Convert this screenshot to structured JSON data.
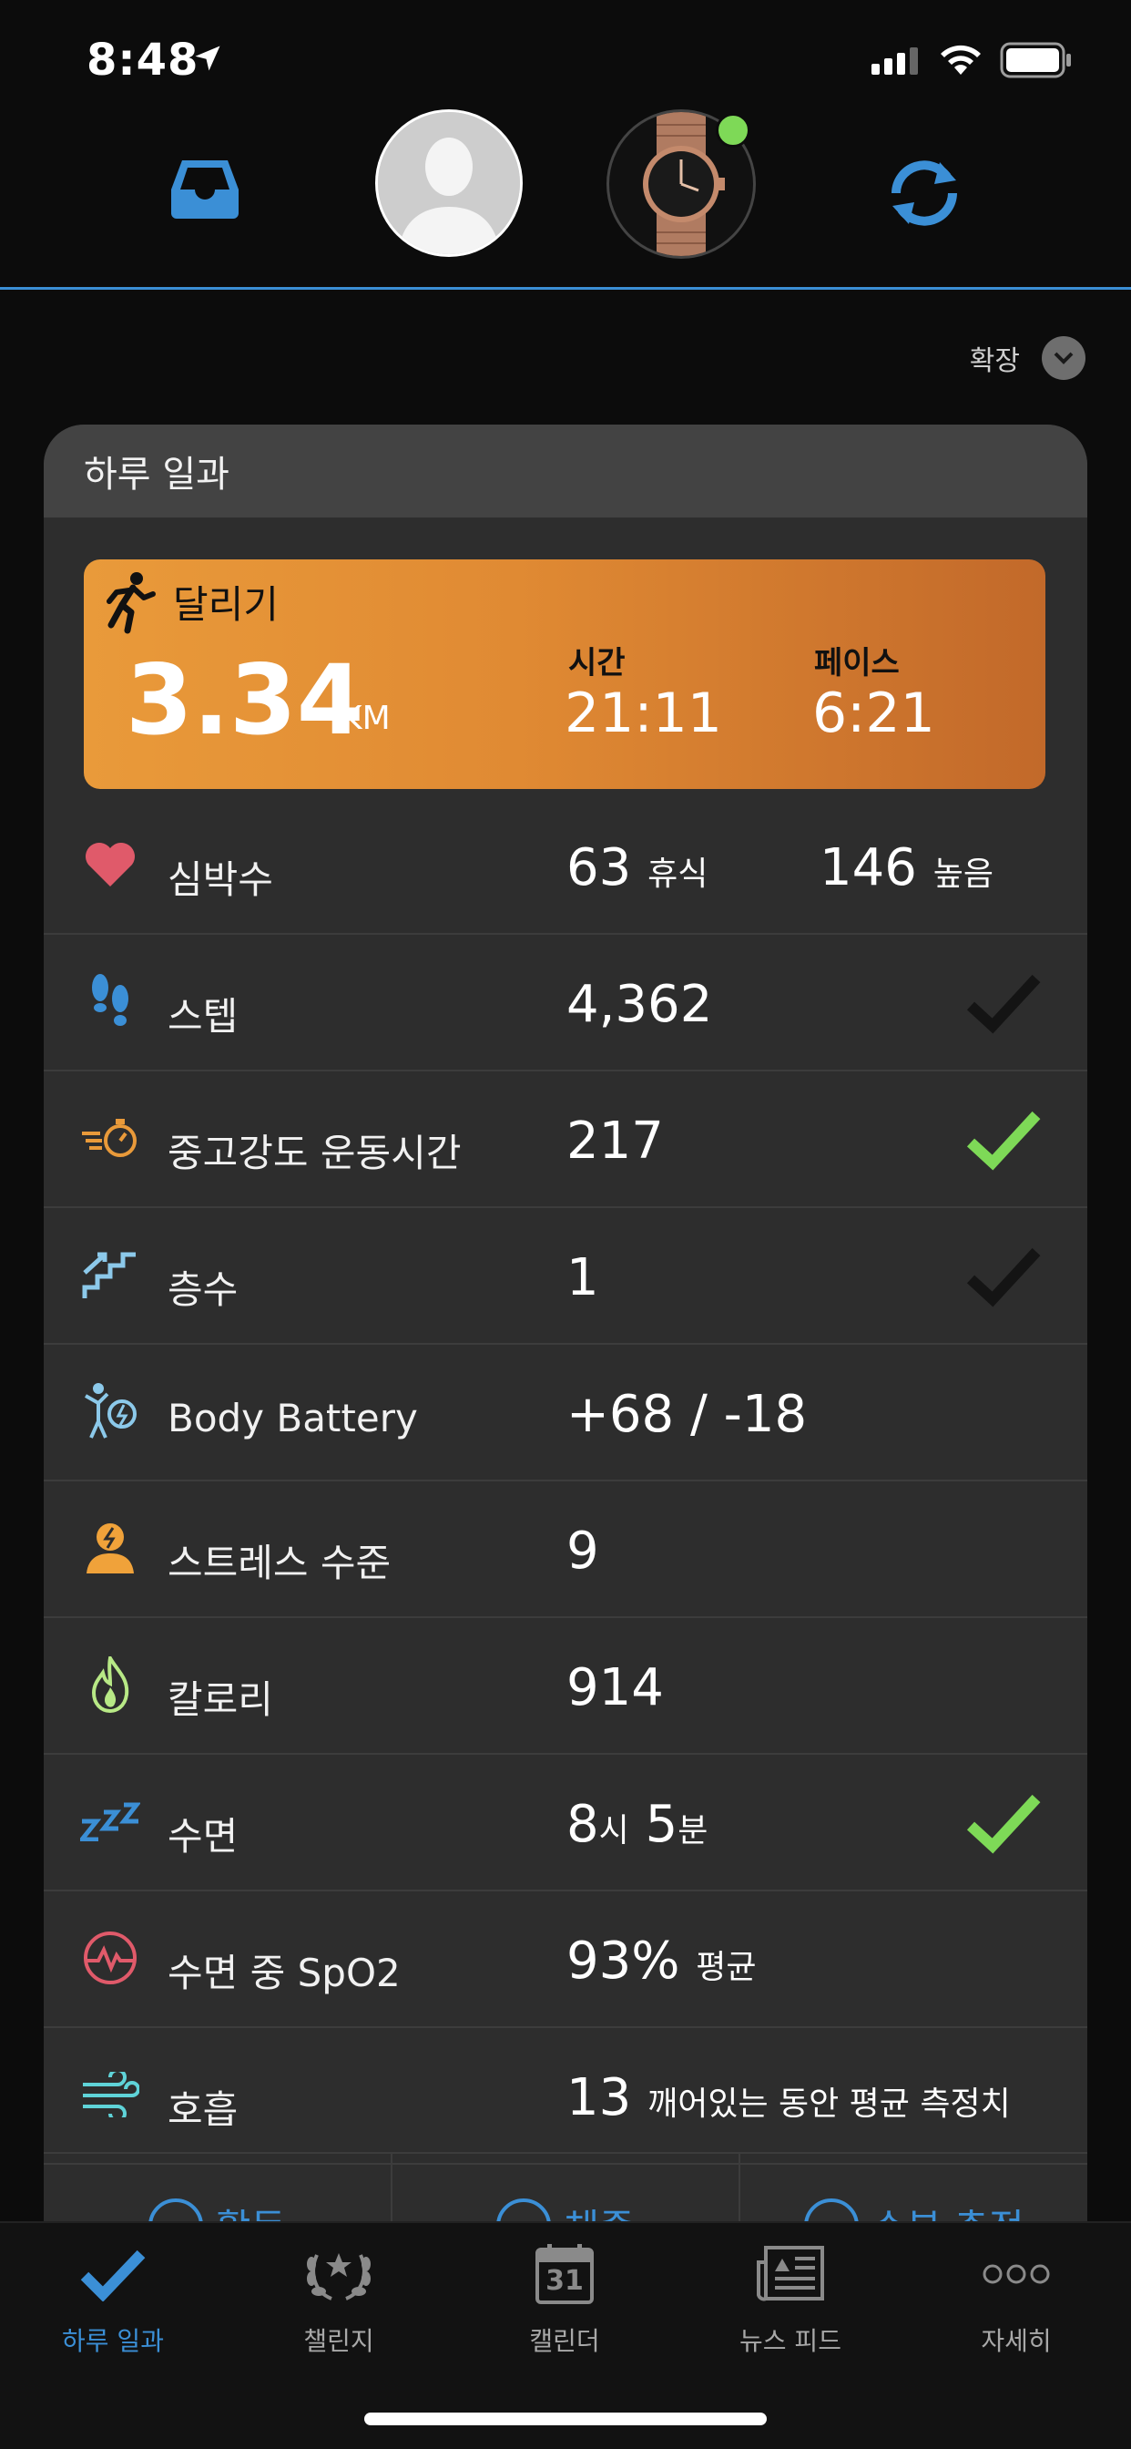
{
  "status_bar": {
    "time": "8:48"
  },
  "header": {
    "watch_connected": true
  },
  "expand": {
    "label": "확장"
  },
  "card": {
    "title": "하루 일과",
    "run": {
      "label": "달리기",
      "distance": "3.34",
      "unit": "KM",
      "time_label": "시간",
      "time_value": "21:11",
      "pace_label": "페이스",
      "pace_value": "6:21"
    },
    "rows": [
      {
        "label": "심박수",
        "value": "63",
        "value_unit": "휴식",
        "value2": "146",
        "value2_unit": "높음",
        "check": "none",
        "icon": "heart-icon"
      },
      {
        "label": "스텝",
        "value": "4,362",
        "check": "dark",
        "icon": "footsteps-icon"
      },
      {
        "label": "중고강도 운동시간",
        "value": "217",
        "check": "green",
        "icon": "intensity-stopwatch-icon"
      },
      {
        "label": "층수",
        "value": "1",
        "check": "dark",
        "icon": "stairs-icon"
      },
      {
        "label": "Body Battery",
        "value": "+68 / -18",
        "check": "none",
        "icon": "body-battery-icon"
      },
      {
        "label": "스트레스 수준",
        "value": "9",
        "check": "none",
        "icon": "stress-icon"
      },
      {
        "label": "칼로리",
        "value": "914",
        "check": "none",
        "icon": "flame-icon"
      },
      {
        "label": "수면",
        "value_parts": [
          "8",
          "시",
          "5",
          "분"
        ],
        "check": "green",
        "icon": "sleep-zzz-icon"
      },
      {
        "label": "수면 중 SpO2",
        "value": "93%",
        "value_unit": "평균",
        "check": "none",
        "icon": "spo2-icon"
      },
      {
        "label": "호흡",
        "value": "13",
        "value_unit": "깨어있는 동안 평균 측정치",
        "check": "none",
        "icon": "respiration-icon"
      }
    ],
    "partial_buttons": [
      "활동",
      "체중",
      "수분 측정"
    ]
  },
  "tabs": [
    {
      "label": "하루 일과",
      "icon": "checkmark-icon",
      "active": true
    },
    {
      "label": "챌린지",
      "icon": "laurel-icon",
      "active": false
    },
    {
      "label": "캘린더",
      "icon": "calendar-icon",
      "calendar_day": "31",
      "active": false
    },
    {
      "label": "뉴스 피드",
      "icon": "newspaper-icon",
      "active": false
    },
    {
      "label": "자세히",
      "icon": "more-dots-icon",
      "active": false
    }
  ],
  "colors": {
    "accent_blue": "#3b8fd6",
    "run_orange_start": "#e99a3a",
    "run_orange_end": "#c2692a",
    "check_green": "#7ed957",
    "heart_red": "#e05a6a"
  }
}
